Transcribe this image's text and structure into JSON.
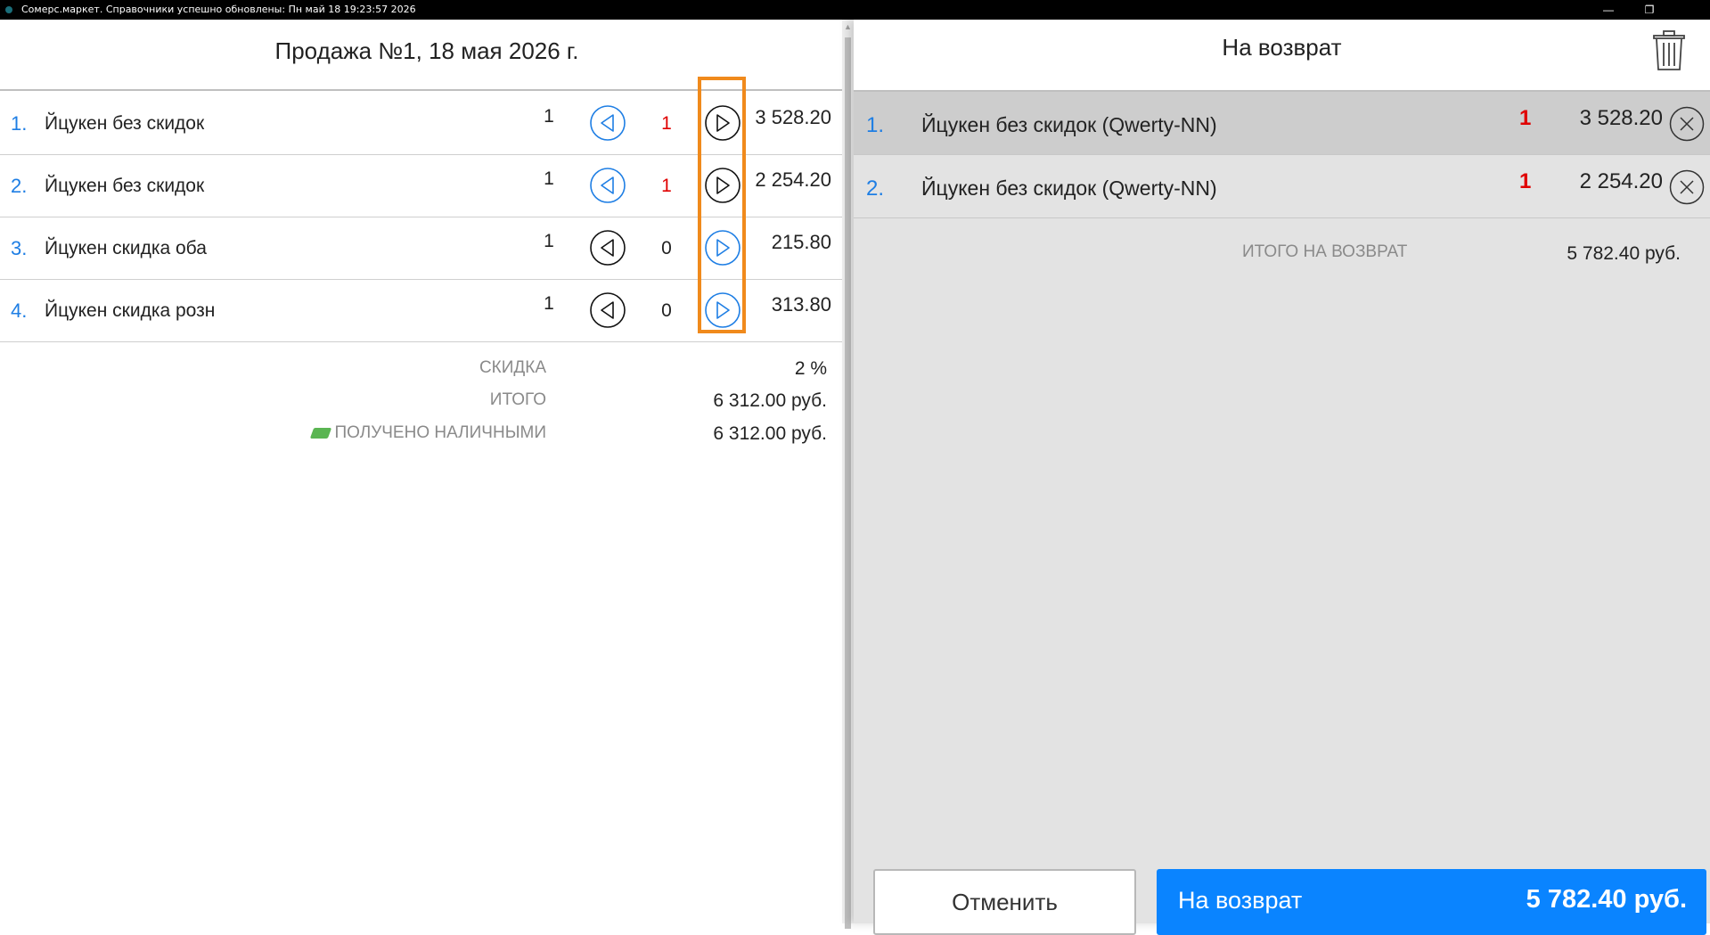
{
  "window": {
    "title": "Сомерс.маркет. Справочники успешно обновлены: Пн май 18 19:23:57 2026",
    "minimize_glyph": "—",
    "restore_glyph": "❐"
  },
  "sale": {
    "title": "Продажа №1, 18 мая 2026 г.",
    "items": [
      {
        "num": "1.",
        "name": "Йцукен без скидок",
        "qty": "1",
        "return_qty": "1",
        "price": "3 528.20",
        "left_active": true,
        "right_active": false
      },
      {
        "num": "2.",
        "name": "Йцукен без скидок",
        "qty": "1",
        "return_qty": "1",
        "price": "2 254.20",
        "left_active": true,
        "right_active": false
      },
      {
        "num": "3.",
        "name": "Йцукен скидка оба",
        "qty": "1",
        "return_qty": "0",
        "price": "215.80",
        "left_active": false,
        "right_active": true
      },
      {
        "num": "4.",
        "name": "Йцукен скидка розн",
        "qty": "1",
        "return_qty": "0",
        "price": "313.80",
        "left_active": false,
        "right_active": true
      }
    ],
    "summary": {
      "discount_label": "СКИДКА",
      "discount_value": "2 %",
      "total_label": "ИТОГО",
      "total_value": "6 312.00 руб.",
      "cash_label": "ПОЛУЧЕНО НАЛИЧНЫМИ",
      "cash_value": "6 312.00 руб."
    }
  },
  "returns": {
    "title": "На возврат",
    "items": [
      {
        "num": "1.",
        "name": "Йцукен без скидок (Qwerty-NN)",
        "count": "1",
        "price": "3 528.20"
      },
      {
        "num": "2.",
        "name": "Йцукен без скидок (Qwerty-NN)",
        "count": "1",
        "price": "2 254.20"
      }
    ],
    "total_label": "ИТОГО НА ВОЗВРАТ",
    "total_value": "5 782.40 руб."
  },
  "actions": {
    "cancel_label": "Отменить",
    "return_label": "На возврат",
    "return_amount": "5 782.40 руб."
  },
  "colors": {
    "accent": "#0a84ff",
    "number_blue": "#1e7ee4",
    "return_count_red": "#e00000",
    "highlight_orange": "#f08a1c"
  },
  "icons": {
    "trash": "trash-icon",
    "arrow_left": "arrow-left-circle-icon",
    "arrow_right": "arrow-right-circle-icon",
    "remove": "close-circle-icon",
    "cash": "cash-icon"
  }
}
